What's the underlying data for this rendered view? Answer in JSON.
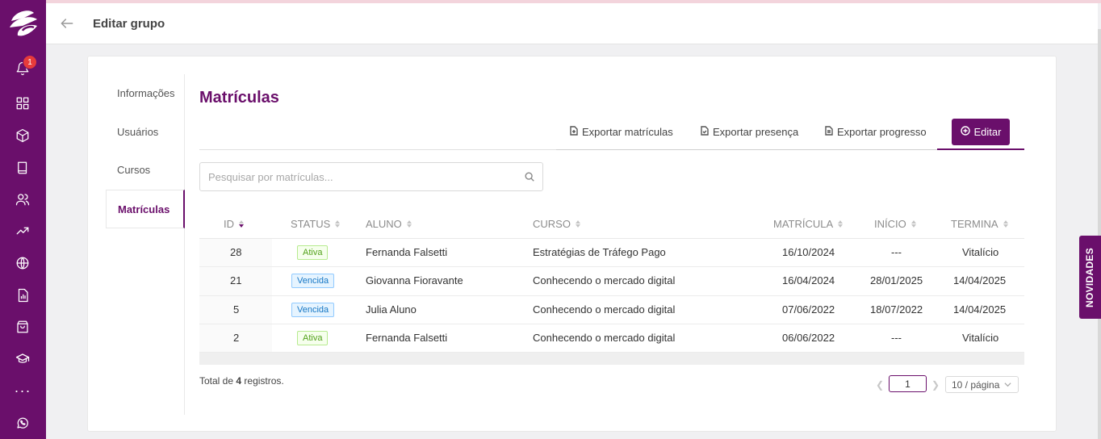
{
  "header": {
    "title": "Editar grupo"
  },
  "sidebar": {
    "notifications_count": "1",
    "icons": [
      "bell-icon",
      "grid-icon",
      "cube-icon",
      "book-icon",
      "users-icon",
      "trending-icon",
      "globe-icon",
      "report-icon",
      "bag-icon",
      "graduation-cap-icon",
      "more-icon",
      "whatsapp-icon"
    ]
  },
  "tabs": {
    "info": "Informações",
    "users": "Usuários",
    "courses": "Cursos",
    "enrollments": "Matrículas",
    "active": "Matrículas"
  },
  "section": {
    "title": "Matrículas"
  },
  "actions": {
    "export_enrollments": "Exportar matrículas",
    "export_attendance": "Exportar presença",
    "export_progress": "Exportar progresso",
    "edit": "Editar"
  },
  "search": {
    "placeholder": "Pesquisar por matrículas..."
  },
  "table": {
    "columns": {
      "id": "ID",
      "status": "STATUS",
      "student": "ALUNO",
      "course": "CURSO",
      "enrollment": "MATRÍCULA",
      "start": "INÍCIO",
      "end": "TERMINA"
    },
    "rows": [
      {
        "id": "28",
        "status": "Ativa",
        "student": "Fernanda Falsetti",
        "course": "Estratégias de Tráfego Pago",
        "enrollment": "16/10/2024",
        "start": "---",
        "end": "Vitalício"
      },
      {
        "id": "21",
        "status": "Vencida",
        "student": "Giovanna Fioravante",
        "course": "Conhecendo o mercado digital",
        "enrollment": "16/04/2024",
        "start": "28/01/2025",
        "end": "14/04/2025"
      },
      {
        "id": "5",
        "status": "Vencida",
        "student": "Julia Aluno",
        "course": "Conhecendo o mercado digital",
        "enrollment": "07/06/2022",
        "start": "18/07/2022",
        "end": "14/04/2025"
      },
      {
        "id": "2",
        "status": "Ativa",
        "student": "Fernanda Falsetti",
        "course": "Conhecendo o mercado digital",
        "enrollment": "06/06/2022",
        "start": "---",
        "end": "Vitalício"
      }
    ]
  },
  "footer": {
    "total_prefix": "Total de ",
    "total_count": "4",
    "total_suffix": " registros.",
    "current_page": "1",
    "page_size": "10 / página"
  },
  "novidades": "NOVIDADES",
  "colors": {
    "brand": "#6a0f6b",
    "active_tag": "#52a11a",
    "expired_tag": "#1677c5"
  }
}
